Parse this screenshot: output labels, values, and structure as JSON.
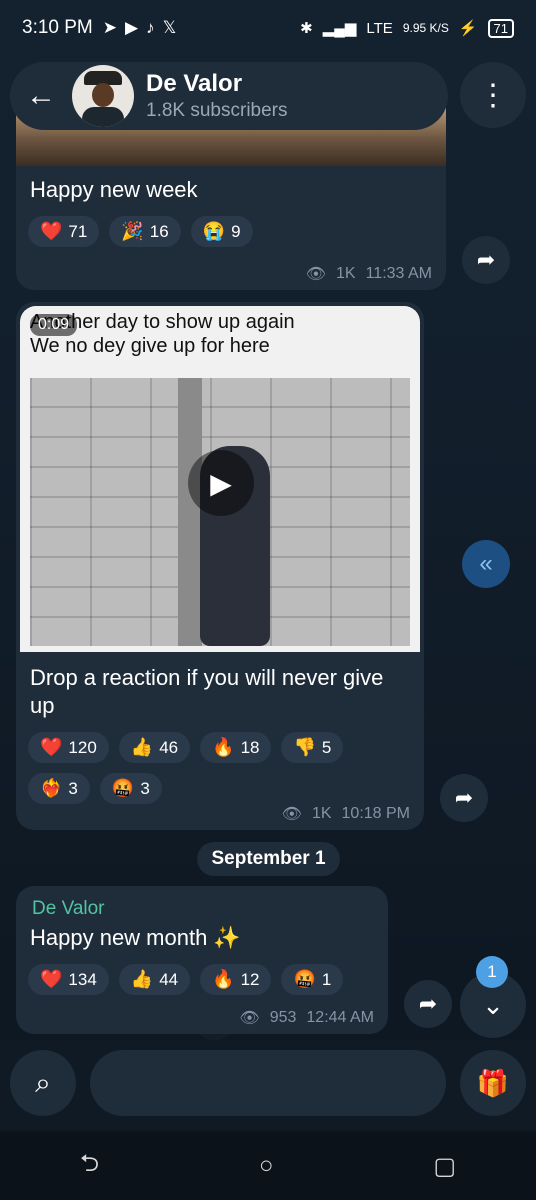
{
  "status_bar": {
    "time": "3:10 PM",
    "notif_icons": [
      "telegram-icon",
      "play-icon",
      "tiktok-icon",
      "x-icon"
    ],
    "net_speed": "9.95 K/S",
    "lte": "LTE",
    "battery": "71"
  },
  "header": {
    "channel_name": "De Valor",
    "subscribers": "1.8K subscribers"
  },
  "messages": [
    {
      "text": "Happy new week",
      "reactions": [
        {
          "emoji": "❤️",
          "count": "71"
        },
        {
          "emoji": "🎉",
          "count": "16"
        },
        {
          "emoji": "😭",
          "count": "9"
        }
      ],
      "views": "1K",
      "time": "11:33 AM"
    },
    {
      "video_caption_line1": "Another day to show up again",
      "video_caption_line2": "We no dey give up for here",
      "duration": "0:09",
      "text": "Drop a reaction if you will never give up",
      "reactions": [
        {
          "emoji": "❤️",
          "count": "120"
        },
        {
          "emoji": "👍",
          "count": "46"
        },
        {
          "emoji": "🔥",
          "count": "18"
        },
        {
          "emoji": "👎",
          "count": "5"
        },
        {
          "emoji": "❤️‍🔥",
          "count": "3"
        },
        {
          "emoji": "🤬",
          "count": "3"
        }
      ],
      "views": "1K",
      "time": "10:18 PM"
    },
    {
      "sender": "De Valor",
      "text": "Happy new month ✨",
      "reactions": [
        {
          "emoji": "❤️",
          "count": "134"
        },
        {
          "emoji": "👍",
          "count": "44"
        },
        {
          "emoji": "🔥",
          "count": "12"
        },
        {
          "emoji": "🤬",
          "count": "1"
        }
      ],
      "views": "953",
      "time": "12:44 AM"
    }
  ],
  "date_chip": "September 1",
  "unread_badge": "1",
  "input": {
    "placeholder": ""
  }
}
